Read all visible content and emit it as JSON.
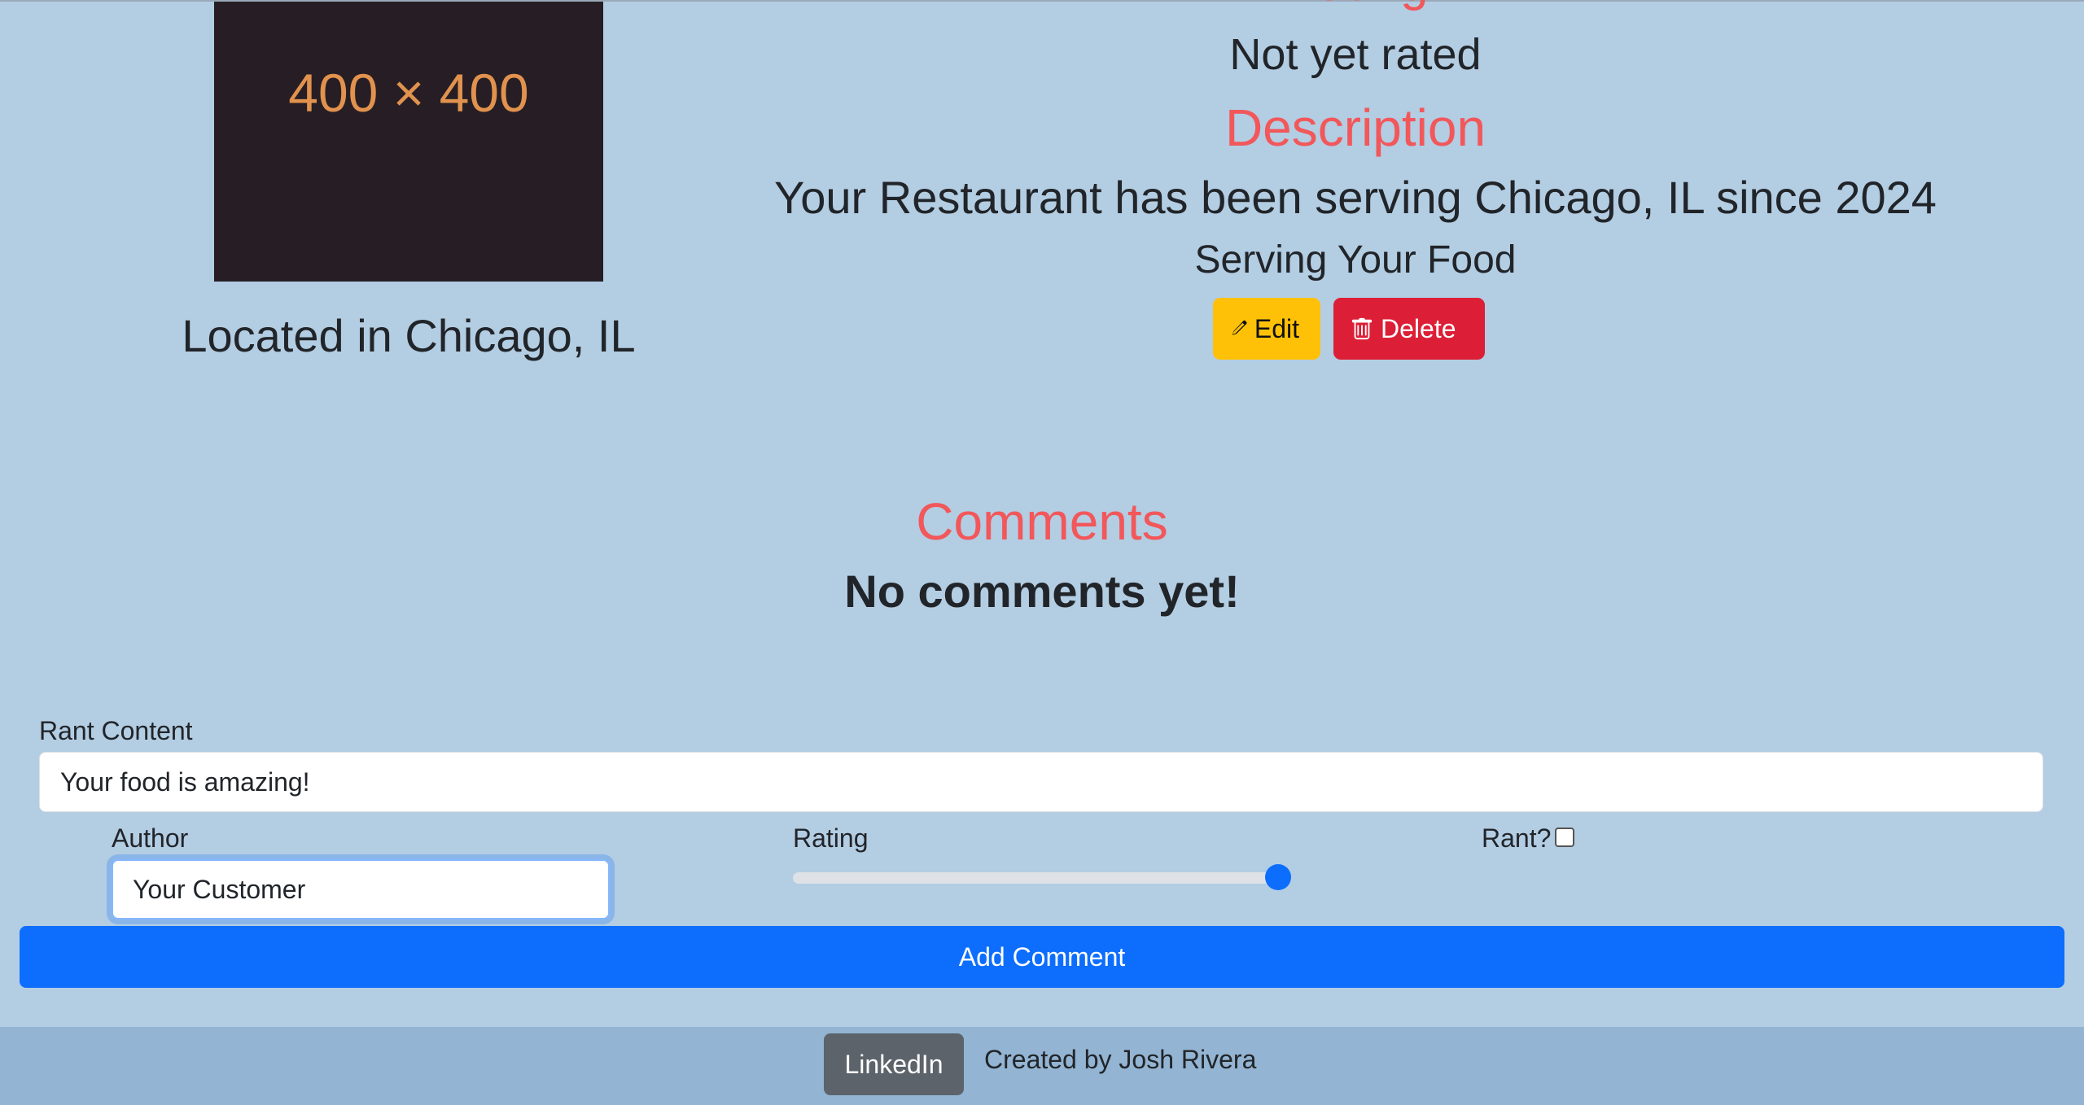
{
  "image": {
    "placeholder_text": "400 × 400"
  },
  "location": "Located in Chicago, IL",
  "rating": {
    "heading": "Rating",
    "value": "Not yet rated"
  },
  "description": {
    "heading": "Description",
    "text": "Your Restaurant has been serving Chicago, IL since 2024",
    "serving": "Serving Your Food"
  },
  "actions": {
    "edit_label": "Edit",
    "delete_label": "Delete",
    "edit_icon": "pencil-icon",
    "delete_icon": "trash-icon",
    "edit_color": "#ffc107",
    "delete_color": "#dc1f36"
  },
  "comments": {
    "heading": "Comments",
    "empty_text": "No comments yet!"
  },
  "form": {
    "rant_content_label": "Rant Content",
    "rant_content_value": "Your food is amazing!",
    "author_label": "Author",
    "author_value": "Your Customer",
    "rating_label": "Rating",
    "rating_value": 1.0,
    "rant_label": "Rant?",
    "rant_checked": false,
    "submit_label": "Add Comment",
    "submit_color": "#0d6efd"
  },
  "footer": {
    "linkedin_label": "LinkedIn",
    "credit": "Created by Josh Rivera"
  },
  "colors": {
    "background": "#b3cde3",
    "heading_accent": "#f2575a",
    "footer": "#93b4d2"
  }
}
